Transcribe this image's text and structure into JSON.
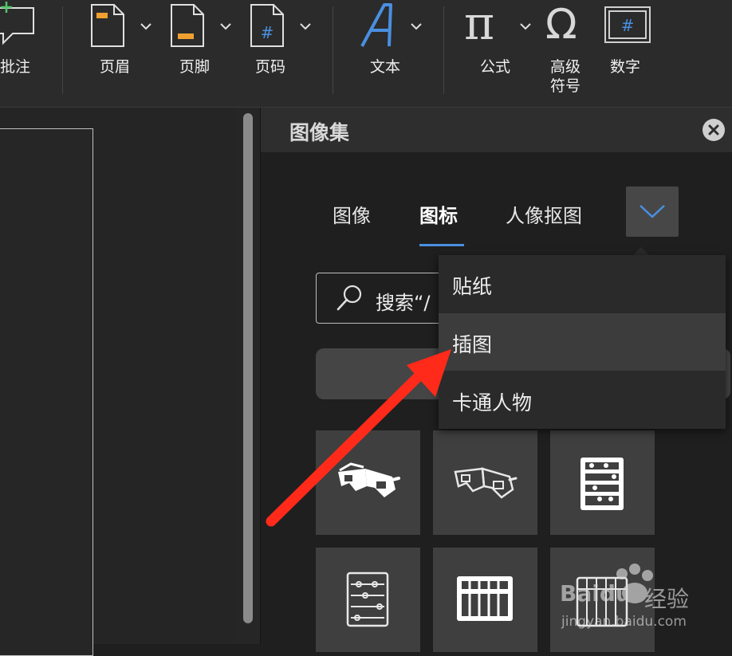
{
  "toolbar": {
    "items": [
      {
        "label": "批注",
        "icon": "comment-add-icon"
      },
      {
        "label": "页眉",
        "icon": "header-icon"
      },
      {
        "label": "页脚",
        "icon": "footer-icon"
      },
      {
        "label": "页码",
        "icon": "page-number-icon",
        "glyph": "#"
      },
      {
        "label": "文本",
        "icon": "text-box-icon"
      },
      {
        "label": "公式",
        "icon": "equation-icon",
        "glyph": "π"
      },
      {
        "label_line1": "高级",
        "label_line2": "符号",
        "icon": "symbol-icon",
        "glyph": "Ω"
      },
      {
        "label": "数字",
        "icon": "number-icon",
        "glyph": "#"
      }
    ]
  },
  "panel": {
    "title": "图像集",
    "tabs": [
      {
        "label": "图像",
        "active": false
      },
      {
        "label": "图标",
        "active": true
      },
      {
        "label": "人像抠图",
        "active": false
      }
    ],
    "search": {
      "text": "搜索“/"
    },
    "tiles": [
      "3d-glasses-icon",
      "3d-glasses-outline-icon",
      "abacus-icon",
      "abacus-outline-icon",
      "abacus-icon",
      "abacus-outline-icon"
    ]
  },
  "dropdown": {
    "items": [
      {
        "label": "贴纸",
        "highlighted": false
      },
      {
        "label": "插图",
        "highlighted": true
      },
      {
        "label": "卡通人物",
        "highlighted": false
      }
    ]
  },
  "watermark": {
    "brand": "Baidu",
    "text": "经验",
    "url": "jingyan.baidu.com"
  },
  "colors": {
    "accent": "#4a8fe0",
    "header_icon": "#f0a030",
    "arrow": "#ff2a1a"
  }
}
